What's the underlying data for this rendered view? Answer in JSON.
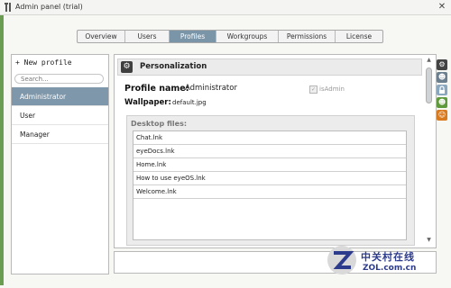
{
  "window": {
    "title": "Admin panel (trial)"
  },
  "tabs": [
    {
      "label": "Overview"
    },
    {
      "label": "Users"
    },
    {
      "label": "Profiles"
    },
    {
      "label": "Workgroups"
    },
    {
      "label": "Permissions"
    },
    {
      "label": "License"
    }
  ],
  "active_tab": "Profiles",
  "sidebar": {
    "new_profile_label": "+ New profile",
    "search_placeholder": "Search...",
    "items": [
      {
        "label": "Administrator"
      },
      {
        "label": "User"
      },
      {
        "label": "Manager"
      }
    ]
  },
  "main": {
    "section_title": "Personalization",
    "profile_name_label": "Profile name:",
    "profile_name_value": "Administrator",
    "wallpaper_label": "Wallpaper:",
    "wallpaper_value": "default.jpg",
    "is_admin_label": "isAdmin",
    "is_admin_checked": true,
    "desktop_files_label": "Desktop files:",
    "desktop_files": [
      "Chat.lnk",
      "eyeDocs.lnk",
      "Home.lnk",
      "How to use eyeOS.lnk",
      "Welcome.lnk"
    ]
  },
  "watermark": {
    "logo_text": "中关村在线",
    "url": "ZOL.com.cn"
  },
  "colors": {
    "accent": "#7a95a8",
    "sidebar_green": "#6a9c51",
    "watermark_blue": "#2c3b8c"
  },
  "right_icons": [
    "gear-icon",
    "people-icon",
    "lock-icon",
    "group-icon",
    "user-icon"
  ]
}
